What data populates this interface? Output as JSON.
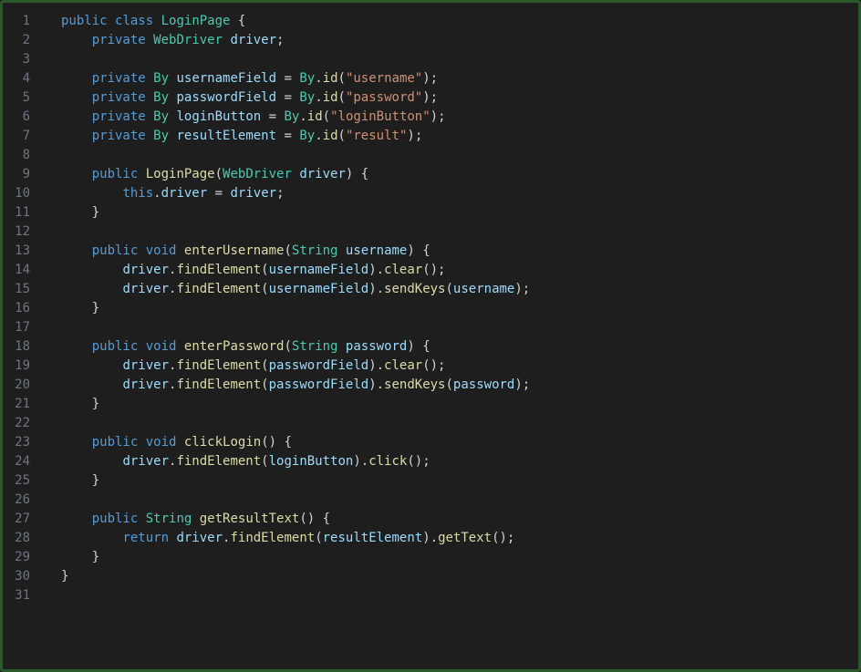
{
  "lines": [
    {
      "n": 1,
      "tokens": [
        [
          "kw",
          "public"
        ],
        [
          "pun",
          " "
        ],
        [
          "kw",
          "class"
        ],
        [
          "pun",
          " "
        ],
        [
          "type",
          "LoginPage"
        ],
        [
          "pun",
          " "
        ],
        [
          "brace",
          "{"
        ]
      ]
    },
    {
      "n": 2,
      "tokens": [
        [
          "pun",
          "    "
        ],
        [
          "kw",
          "private"
        ],
        [
          "pun",
          " "
        ],
        [
          "type",
          "WebDriver"
        ],
        [
          "pun",
          " "
        ],
        [
          "var",
          "driver"
        ],
        [
          "pun",
          ";"
        ]
      ]
    },
    {
      "n": 3,
      "tokens": []
    },
    {
      "n": 4,
      "tokens": [
        [
          "pun",
          "    "
        ],
        [
          "kw",
          "private"
        ],
        [
          "pun",
          " "
        ],
        [
          "type",
          "By"
        ],
        [
          "pun",
          " "
        ],
        [
          "var",
          "usernameField"
        ],
        [
          "pun",
          " "
        ],
        [
          "op",
          "="
        ],
        [
          "pun",
          " "
        ],
        [
          "type",
          "By"
        ],
        [
          "pun",
          "."
        ],
        [
          "fn",
          "id"
        ],
        [
          "pun",
          "("
        ],
        [
          "str",
          "\"username\""
        ],
        [
          "pun",
          ");"
        ]
      ]
    },
    {
      "n": 5,
      "tokens": [
        [
          "pun",
          "    "
        ],
        [
          "kw",
          "private"
        ],
        [
          "pun",
          " "
        ],
        [
          "type",
          "By"
        ],
        [
          "pun",
          " "
        ],
        [
          "var",
          "passwordField"
        ],
        [
          "pun",
          " "
        ],
        [
          "op",
          "="
        ],
        [
          "pun",
          " "
        ],
        [
          "type",
          "By"
        ],
        [
          "pun",
          "."
        ],
        [
          "fn",
          "id"
        ],
        [
          "pun",
          "("
        ],
        [
          "str",
          "\"password\""
        ],
        [
          "pun",
          ");"
        ]
      ]
    },
    {
      "n": 6,
      "tokens": [
        [
          "pun",
          "    "
        ],
        [
          "kw",
          "private"
        ],
        [
          "pun",
          " "
        ],
        [
          "type",
          "By"
        ],
        [
          "pun",
          " "
        ],
        [
          "var",
          "loginButton"
        ],
        [
          "pun",
          " "
        ],
        [
          "op",
          "="
        ],
        [
          "pun",
          " "
        ],
        [
          "type",
          "By"
        ],
        [
          "pun",
          "."
        ],
        [
          "fn",
          "id"
        ],
        [
          "pun",
          "("
        ],
        [
          "str",
          "\"loginButton\""
        ],
        [
          "pun",
          ");"
        ]
      ]
    },
    {
      "n": 7,
      "tokens": [
        [
          "pun",
          "    "
        ],
        [
          "kw",
          "private"
        ],
        [
          "pun",
          " "
        ],
        [
          "type",
          "By"
        ],
        [
          "pun",
          " "
        ],
        [
          "var",
          "resultElement"
        ],
        [
          "pun",
          " "
        ],
        [
          "op",
          "="
        ],
        [
          "pun",
          " "
        ],
        [
          "type",
          "By"
        ],
        [
          "pun",
          "."
        ],
        [
          "fn",
          "id"
        ],
        [
          "pun",
          "("
        ],
        [
          "str",
          "\"result\""
        ],
        [
          "pun",
          ");"
        ]
      ]
    },
    {
      "n": 8,
      "tokens": []
    },
    {
      "n": 9,
      "tokens": [
        [
          "pun",
          "    "
        ],
        [
          "kw",
          "public"
        ],
        [
          "pun",
          " "
        ],
        [
          "fn",
          "LoginPage"
        ],
        [
          "pun",
          "("
        ],
        [
          "type",
          "WebDriver"
        ],
        [
          "pun",
          " "
        ],
        [
          "var",
          "driver"
        ],
        [
          "pun",
          ") "
        ],
        [
          "brace",
          "{"
        ]
      ]
    },
    {
      "n": 10,
      "tokens": [
        [
          "pun",
          "        "
        ],
        [
          "this",
          "this"
        ],
        [
          "pun",
          "."
        ],
        [
          "var",
          "driver"
        ],
        [
          "pun",
          " "
        ],
        [
          "op",
          "="
        ],
        [
          "pun",
          " "
        ],
        [
          "var",
          "driver"
        ],
        [
          "pun",
          ";"
        ]
      ]
    },
    {
      "n": 11,
      "tokens": [
        [
          "pun",
          "    "
        ],
        [
          "brace",
          "}"
        ]
      ]
    },
    {
      "n": 12,
      "tokens": []
    },
    {
      "n": 13,
      "tokens": [
        [
          "pun",
          "    "
        ],
        [
          "kw",
          "public"
        ],
        [
          "pun",
          " "
        ],
        [
          "kw",
          "void"
        ],
        [
          "pun",
          " "
        ],
        [
          "fn",
          "enterUsername"
        ],
        [
          "pun",
          "("
        ],
        [
          "type",
          "String"
        ],
        [
          "pun",
          " "
        ],
        [
          "var",
          "username"
        ],
        [
          "pun",
          ") "
        ],
        [
          "brace",
          "{"
        ]
      ]
    },
    {
      "n": 14,
      "tokens": [
        [
          "pun",
          "        "
        ],
        [
          "var",
          "driver"
        ],
        [
          "pun",
          "."
        ],
        [
          "fn",
          "findElement"
        ],
        [
          "pun",
          "("
        ],
        [
          "var",
          "usernameField"
        ],
        [
          "pun",
          ")."
        ],
        [
          "fn",
          "clear"
        ],
        [
          "pun",
          "();"
        ]
      ]
    },
    {
      "n": 15,
      "tokens": [
        [
          "pun",
          "        "
        ],
        [
          "var",
          "driver"
        ],
        [
          "pun",
          "."
        ],
        [
          "fn",
          "findElement"
        ],
        [
          "pun",
          "("
        ],
        [
          "var",
          "usernameField"
        ],
        [
          "pun",
          ")."
        ],
        [
          "fn",
          "sendKeys"
        ],
        [
          "pun",
          "("
        ],
        [
          "var",
          "username"
        ],
        [
          "pun",
          ");"
        ]
      ]
    },
    {
      "n": 16,
      "tokens": [
        [
          "pun",
          "    "
        ],
        [
          "brace",
          "}"
        ]
      ]
    },
    {
      "n": 17,
      "tokens": []
    },
    {
      "n": 18,
      "tokens": [
        [
          "pun",
          "    "
        ],
        [
          "kw",
          "public"
        ],
        [
          "pun",
          " "
        ],
        [
          "kw",
          "void"
        ],
        [
          "pun",
          " "
        ],
        [
          "fn",
          "enterPassword"
        ],
        [
          "pun",
          "("
        ],
        [
          "type",
          "String"
        ],
        [
          "pun",
          " "
        ],
        [
          "var",
          "password"
        ],
        [
          "pun",
          ") "
        ],
        [
          "brace",
          "{"
        ]
      ]
    },
    {
      "n": 19,
      "tokens": [
        [
          "pun",
          "        "
        ],
        [
          "var",
          "driver"
        ],
        [
          "pun",
          "."
        ],
        [
          "fn",
          "findElement"
        ],
        [
          "pun",
          "("
        ],
        [
          "var",
          "passwordField"
        ],
        [
          "pun",
          ")."
        ],
        [
          "fn",
          "clear"
        ],
        [
          "pun",
          "();"
        ]
      ]
    },
    {
      "n": 20,
      "tokens": [
        [
          "pun",
          "        "
        ],
        [
          "var",
          "driver"
        ],
        [
          "pun",
          "."
        ],
        [
          "fn",
          "findElement"
        ],
        [
          "pun",
          "("
        ],
        [
          "var",
          "passwordField"
        ],
        [
          "pun",
          ")."
        ],
        [
          "fn",
          "sendKeys"
        ],
        [
          "pun",
          "("
        ],
        [
          "var",
          "password"
        ],
        [
          "pun",
          ");"
        ]
      ]
    },
    {
      "n": 21,
      "tokens": [
        [
          "pun",
          "    "
        ],
        [
          "brace",
          "}"
        ]
      ]
    },
    {
      "n": 22,
      "tokens": []
    },
    {
      "n": 23,
      "tokens": [
        [
          "pun",
          "    "
        ],
        [
          "kw",
          "public"
        ],
        [
          "pun",
          " "
        ],
        [
          "kw",
          "void"
        ],
        [
          "pun",
          " "
        ],
        [
          "fn",
          "clickLogin"
        ],
        [
          "pun",
          "() "
        ],
        [
          "brace",
          "{"
        ]
      ]
    },
    {
      "n": 24,
      "tokens": [
        [
          "pun",
          "        "
        ],
        [
          "var",
          "driver"
        ],
        [
          "pun",
          "."
        ],
        [
          "fn",
          "findElement"
        ],
        [
          "pun",
          "("
        ],
        [
          "var",
          "loginButton"
        ],
        [
          "pun",
          ")."
        ],
        [
          "fn",
          "click"
        ],
        [
          "pun",
          "();"
        ]
      ]
    },
    {
      "n": 25,
      "tokens": [
        [
          "pun",
          "    "
        ],
        [
          "brace",
          "}"
        ]
      ]
    },
    {
      "n": 26,
      "tokens": []
    },
    {
      "n": 27,
      "tokens": [
        [
          "pun",
          "    "
        ],
        [
          "kw",
          "public"
        ],
        [
          "pun",
          " "
        ],
        [
          "type",
          "String"
        ],
        [
          "pun",
          " "
        ],
        [
          "fn",
          "getResultText"
        ],
        [
          "pun",
          "() "
        ],
        [
          "brace",
          "{"
        ]
      ]
    },
    {
      "n": 28,
      "tokens": [
        [
          "pun",
          "        "
        ],
        [
          "kw",
          "return"
        ],
        [
          "pun",
          " "
        ],
        [
          "var",
          "driver"
        ],
        [
          "pun",
          "."
        ],
        [
          "fn",
          "findElement"
        ],
        [
          "pun",
          "("
        ],
        [
          "var",
          "resultElement"
        ],
        [
          "pun",
          ")."
        ],
        [
          "fn",
          "getText"
        ],
        [
          "pun",
          "();"
        ]
      ]
    },
    {
      "n": 29,
      "tokens": [
        [
          "pun",
          "    "
        ],
        [
          "brace",
          "}"
        ]
      ]
    },
    {
      "n": 30,
      "tokens": [
        [
          "brace",
          "}"
        ]
      ]
    },
    {
      "n": 31,
      "tokens": []
    }
  ]
}
